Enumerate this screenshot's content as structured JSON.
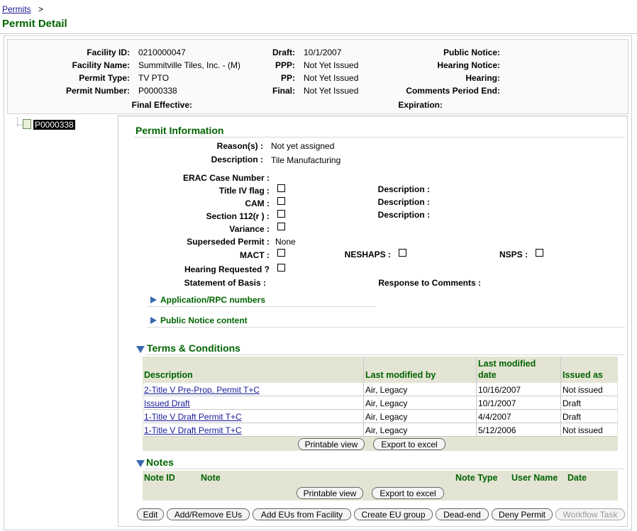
{
  "breadcrumb": {
    "link": "Permits",
    "separator": ">"
  },
  "page_title": "Permit Detail",
  "summary": {
    "facility_id_label": "Facility ID:",
    "facility_id": "0210000047",
    "facility_name_label": "Facility Name:",
    "facility_name": "Summitville Tiles, Inc. - (M)",
    "permit_type_label": "Permit Type:",
    "permit_type": "TV PTO",
    "permit_number_label": "Permit Number:",
    "permit_number": "P0000338",
    "final_effective_label": "Final Effective:",
    "draft_label": "Draft:",
    "draft": "10/1/2007",
    "ppp_label": "PPP:",
    "ppp": "Not Yet Issued",
    "pp_label": "PP:",
    "pp": "Not Yet Issued",
    "final_label": "Final:",
    "final": "Not Yet Issued",
    "expiration_label": "Expiration:",
    "public_notice_label": "Public Notice:",
    "hearing_notice_label": "Hearing Notice:",
    "hearing_label": "Hearing:",
    "comments_end_label": "Comments Period End:"
  },
  "tree": {
    "node": "P0000338"
  },
  "permit_info": {
    "title": "Permit Information",
    "reasons_label": "Reason(s) :",
    "reasons": "Not yet assigned",
    "description_label": "Description :",
    "description": "Tile Manufacturing",
    "erac_label": "ERAC Case Number :",
    "title_iv_label": "Title IV flag :",
    "cam_label": "CAM :",
    "section112_label": "Section 112(r ) :",
    "variance_label": "Variance :",
    "superseded_label": "Superseded Permit :",
    "superseded": "None",
    "mact_label": "MACT :",
    "neshaps_label": "NESHAPS :",
    "nsps_label": "NSPS :",
    "hearing_req_label": "Hearing Requested ?",
    "statement_label": "Statement of Basis :",
    "response_label": "Response to Comments :",
    "desc1_label": "Description :",
    "desc2_label": "Description :",
    "desc3_label": "Description :",
    "app_rpc": "Application/RPC numbers",
    "public_notice_content": "Public Notice content"
  },
  "terms": {
    "title": "Terms & Conditions",
    "headers": [
      "Description",
      "Last modified by",
      "Last modified",
      "date",
      "Issued as"
    ],
    "rows": [
      {
        "description": "2-Title V Pre-Prop. Permit T+C",
        "by": "Air, Legacy",
        "date": "10/16/2007",
        "issued": "Not issued"
      },
      {
        "description": "Issued Draft",
        "by": "Air, Legacy",
        "date": "10/1/2007",
        "issued": "Draft"
      },
      {
        "description": "1-Title V Draft Permit T+C",
        "by": "Air, Legacy",
        "date": "4/4/2007",
        "issued": "Draft"
      },
      {
        "description": "1-Title V Draft Permit T+C",
        "by": "Air, Legacy",
        "date": "5/12/2006",
        "issued": "Not issued"
      }
    ],
    "printable": "Printable view",
    "export": "Export to excel"
  },
  "notes": {
    "title": "Notes",
    "headers": [
      "Note ID",
      "Note",
      "Note Type",
      "User Name",
      "Date"
    ],
    "printable": "Printable view",
    "export": "Export to excel"
  },
  "actions": {
    "edit": "Edit",
    "add_remove_eus": "Add/Remove EUs",
    "add_eus_facility": "Add EUs from Facility",
    "create_eu_group": "Create EU group",
    "dead_end": "Dead-end",
    "deny_permit": "Deny Permit",
    "workflow_task": "Workflow Task"
  },
  "colors": {
    "heading_green": "#006400",
    "link_blue": "#1a1a99",
    "table_bg": "#e4e4d4",
    "toggle_blue": "#3a6ab0"
  }
}
